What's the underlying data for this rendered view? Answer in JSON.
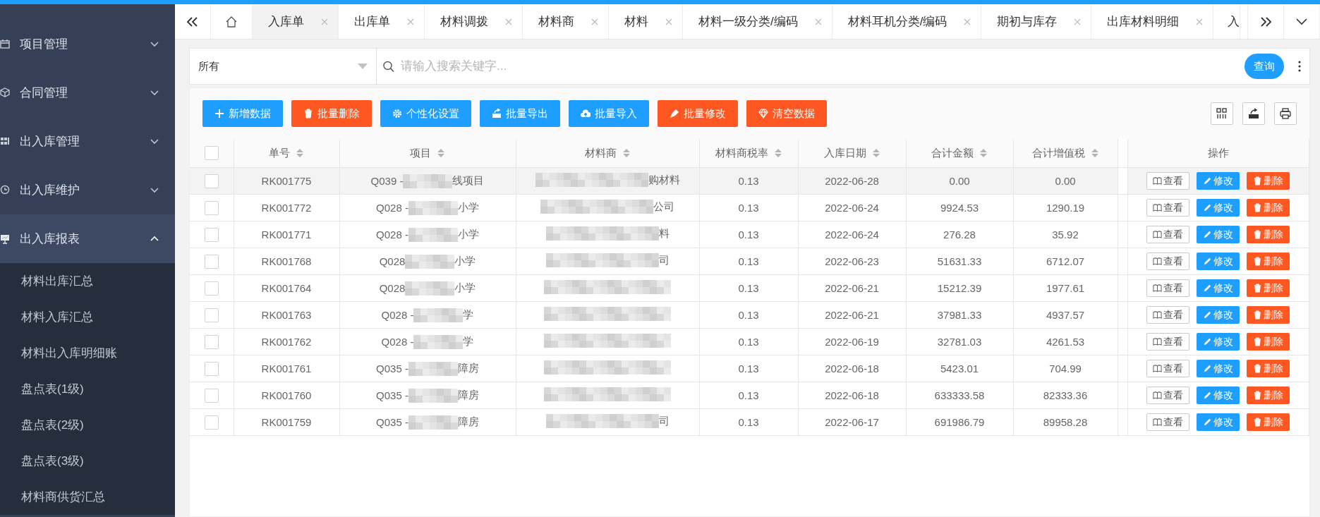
{
  "sidebar": {
    "items": [
      {
        "label": "项目管理",
        "expanded": false
      },
      {
        "label": "合同管理",
        "expanded": false
      },
      {
        "label": "出入库管理",
        "expanded": false
      },
      {
        "label": "出入库维护",
        "expanded": false
      },
      {
        "label": "出入库报表",
        "expanded": true,
        "children": [
          {
            "label": "材料出库汇总"
          },
          {
            "label": "材料入库汇总"
          },
          {
            "label": "材料出入库明细账"
          },
          {
            "label": "盘点表(1级)"
          },
          {
            "label": "盘点表(2级)"
          },
          {
            "label": "盘点表(3级)"
          },
          {
            "label": "材料商供货汇总"
          }
        ]
      }
    ]
  },
  "tabs": [
    {
      "kind": "home",
      "selected": false
    },
    {
      "kind": "page",
      "label": "入库单",
      "selected": true,
      "closable": true
    },
    {
      "kind": "page",
      "label": "出库单",
      "selected": false,
      "closable": true
    },
    {
      "kind": "page",
      "label": "材料调拨",
      "selected": false,
      "closable": true
    },
    {
      "kind": "page",
      "label": "材料商",
      "selected": false,
      "closable": true
    },
    {
      "kind": "page",
      "label": "材料",
      "selected": false,
      "closable": true
    },
    {
      "kind": "page",
      "label": "材料一级分类/编码",
      "selected": false,
      "closable": true
    },
    {
      "kind": "page",
      "label": "材料耳机分类/编码",
      "selected": false,
      "closable": true
    },
    {
      "kind": "page",
      "label": "期初与库存",
      "selected": false,
      "closable": true
    },
    {
      "kind": "page",
      "label": "出库材料明细",
      "selected": false,
      "closable": true
    },
    {
      "kind": "page",
      "label": "入",
      "selected": false,
      "closable": false
    }
  ],
  "search": {
    "filter_value": "所有",
    "placeholder": "请输入搜索关键字...",
    "button": "查询"
  },
  "toolbar": {
    "buttons": [
      {
        "label": "新增数据",
        "kind": "primary"
      },
      {
        "label": "批量删除",
        "kind": "danger"
      },
      {
        "label": "个性化设置",
        "kind": "primary"
      },
      {
        "label": "批量导出",
        "kind": "primary"
      },
      {
        "label": "批量导入",
        "kind": "primary"
      },
      {
        "label": "批量修改",
        "kind": "danger"
      },
      {
        "label": "清空数据",
        "kind": "danger"
      }
    ]
  },
  "table": {
    "select_all_checked": false,
    "columns": [
      {
        "label": "单号",
        "sortable": true
      },
      {
        "label": "项目",
        "sortable": true
      },
      {
        "label": "材料商",
        "sortable": true
      },
      {
        "label": "材料商税率",
        "sortable": true
      },
      {
        "label": "入库日期",
        "sortable": true
      },
      {
        "label": "合计金额",
        "sortable": true
      },
      {
        "label": "合计增值税",
        "sortable": true
      },
      {
        "label": "操作",
        "sortable": false
      }
    ],
    "rows": [
      {
        "checked": false,
        "hovered": true,
        "number": "RK001775",
        "project_prefix": "Q039 -",
        "project_suffix": "线项目",
        "supplier_suffix": "购材料",
        "tax_rate": "0.13",
        "date": "2022-06-28",
        "total": "0.00",
        "vat": "0.00",
        "actions": [
          {
            "label": "查看",
            "kind": "view"
          },
          {
            "label": "修改",
            "kind": "edit"
          },
          {
            "label": "删除",
            "kind": "delete"
          }
        ]
      },
      {
        "checked": false,
        "hovered": false,
        "number": "RK001772",
        "project_prefix": "Q028 -",
        "project_suffix": "小学",
        "supplier_suffix": "公司",
        "tax_rate": "0.13",
        "date": "2022-06-24",
        "total": "9924.53",
        "vat": "1290.19",
        "actions": [
          {
            "label": "查看",
            "kind": "view"
          },
          {
            "label": "修改",
            "kind": "edit"
          },
          {
            "label": "删除",
            "kind": "delete"
          }
        ]
      },
      {
        "checked": false,
        "hovered": false,
        "number": "RK001771",
        "project_prefix": "Q028 -",
        "project_suffix": "小学",
        "supplier_suffix": "料",
        "tax_rate": "0.13",
        "date": "2022-06-24",
        "total": "276.28",
        "vat": "35.92",
        "actions": [
          {
            "label": "查看",
            "kind": "view"
          },
          {
            "label": "修改",
            "kind": "edit"
          },
          {
            "label": "删除",
            "kind": "delete"
          }
        ]
      },
      {
        "checked": false,
        "hovered": false,
        "number": "RK001768",
        "project_prefix": "Q028",
        "project_suffix": "小学",
        "supplier_suffix": "司",
        "tax_rate": "0.13",
        "date": "2022-06-23",
        "total": "51631.33",
        "vat": "6712.07",
        "actions": [
          {
            "label": "查看",
            "kind": "view"
          },
          {
            "label": "修改",
            "kind": "edit"
          },
          {
            "label": "删除",
            "kind": "delete"
          }
        ]
      },
      {
        "checked": false,
        "hovered": false,
        "number": "RK001764",
        "project_prefix": "Q028",
        "project_suffix": "小学",
        "tax_rate": "0.13",
        "date": "2022-06-21",
        "total": "15212.39",
        "vat": "1977.61",
        "actions": [
          {
            "label": "查看",
            "kind": "view"
          },
          {
            "label": "修改",
            "kind": "edit"
          },
          {
            "label": "删除",
            "kind": "delete"
          }
        ]
      },
      {
        "checked": false,
        "hovered": false,
        "number": "RK001763",
        "project_prefix": "Q028 -",
        "project_suffix": "学",
        "tax_rate": "0.13",
        "date": "2022-06-21",
        "total": "37981.33",
        "vat": "4937.57",
        "actions": [
          {
            "label": "查看",
            "kind": "view"
          },
          {
            "label": "修改",
            "kind": "edit"
          },
          {
            "label": "删除",
            "kind": "delete"
          }
        ]
      },
      {
        "checked": false,
        "hovered": false,
        "number": "RK001762",
        "project_prefix": "Q028 -",
        "project_suffix": "学",
        "tax_rate": "0.13",
        "date": "2022-06-19",
        "total": "32781.03",
        "vat": "4261.53",
        "actions": [
          {
            "label": "查看",
            "kind": "view"
          },
          {
            "label": "修改",
            "kind": "edit"
          },
          {
            "label": "删除",
            "kind": "delete"
          }
        ]
      },
      {
        "checked": false,
        "hovered": false,
        "number": "RK001761",
        "project_prefix": "Q035 -",
        "project_suffix": "障房",
        "tax_rate": "0.13",
        "date": "2022-06-18",
        "total": "5423.01",
        "vat": "704.99",
        "actions": [
          {
            "label": "查看",
            "kind": "view"
          },
          {
            "label": "修改",
            "kind": "edit"
          },
          {
            "label": "删除",
            "kind": "delete"
          }
        ]
      },
      {
        "checked": false,
        "hovered": false,
        "number": "RK001760",
        "project_prefix": "Q035 -",
        "project_suffix": "障房",
        "tax_rate": "0.13",
        "date": "2022-06-18",
        "total": "633333.58",
        "vat": "82333.36",
        "actions": [
          {
            "label": "查看",
            "kind": "view"
          },
          {
            "label": "修改",
            "kind": "edit"
          },
          {
            "label": "删除",
            "kind": "delete"
          }
        ]
      },
      {
        "checked": false,
        "hovered": false,
        "number": "RK001759",
        "project_prefix": "Q035 -",
        "project_suffix": "障房",
        "supplier_suffix": "司",
        "tax_rate": "0.13",
        "date": "2022-06-17",
        "total": "691986.79",
        "vat": "89958.28",
        "actions": [
          {
            "label": "查看",
            "kind": "view"
          },
          {
            "label": "修改",
            "kind": "edit"
          },
          {
            "label": "删除",
            "kind": "delete"
          }
        ]
      }
    ]
  }
}
